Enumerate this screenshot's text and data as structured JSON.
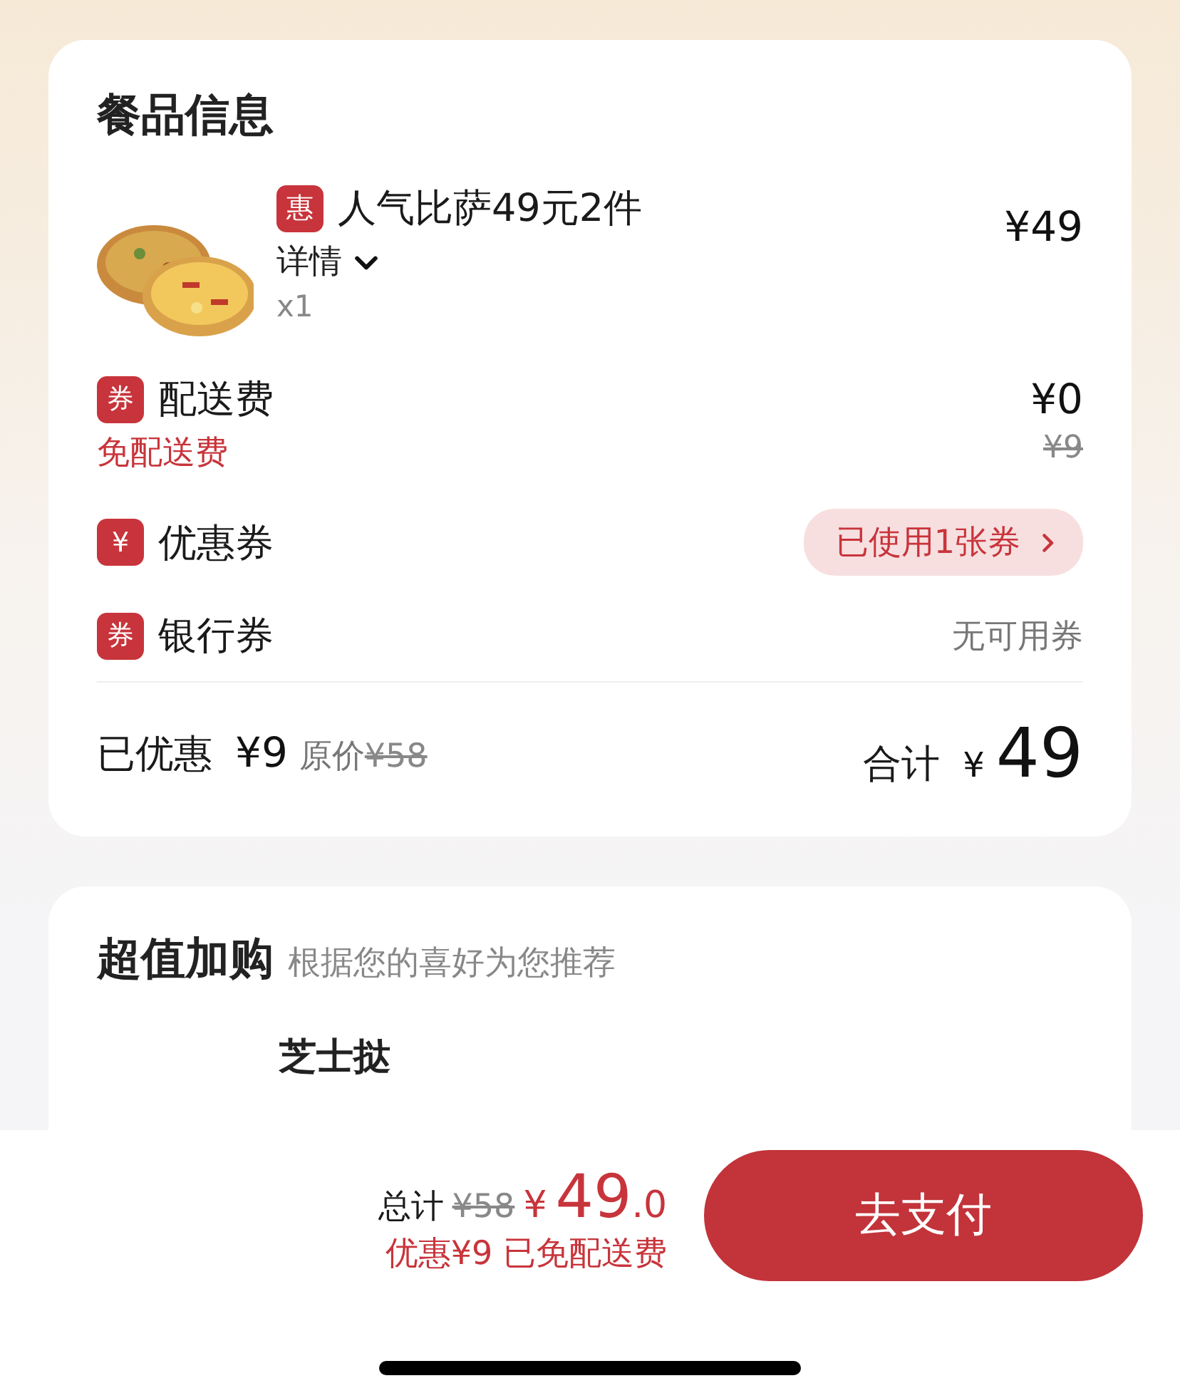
{
  "order_card": {
    "title": "餐品信息",
    "item": {
      "badge": "惠",
      "name": "人气比萨49元2件",
      "details_label": "详情",
      "quantity": "x1",
      "price": "¥49"
    },
    "fee_rows": [
      {
        "kind": "fee",
        "badge": "券",
        "label": "配送费",
        "value": "¥0",
        "note": "免配送费",
        "original": "¥9"
      },
      {
        "kind": "pill",
        "badge": "¥",
        "label": "优惠券",
        "value": "已使用1张券"
      },
      {
        "kind": "plain",
        "badge": "券",
        "label": "银行券",
        "value": "无可用券"
      }
    ],
    "summary": {
      "saved_label": "已优惠",
      "saved": "¥9",
      "original_label": "原价",
      "original": "¥58",
      "total_label": "合计",
      "currency": "¥",
      "total": "49"
    }
  },
  "addon_card": {
    "title": "超值加购",
    "subtitle": "根据您的喜好为您推荐",
    "first_item": "芝士挞"
  },
  "checkout_bar": {
    "total_label": "总计",
    "original": "¥58",
    "currency": "¥",
    "amount": "49",
    "decimals": ".0",
    "note": "优惠¥9 已免配送费",
    "pay_button": "去支付"
  }
}
